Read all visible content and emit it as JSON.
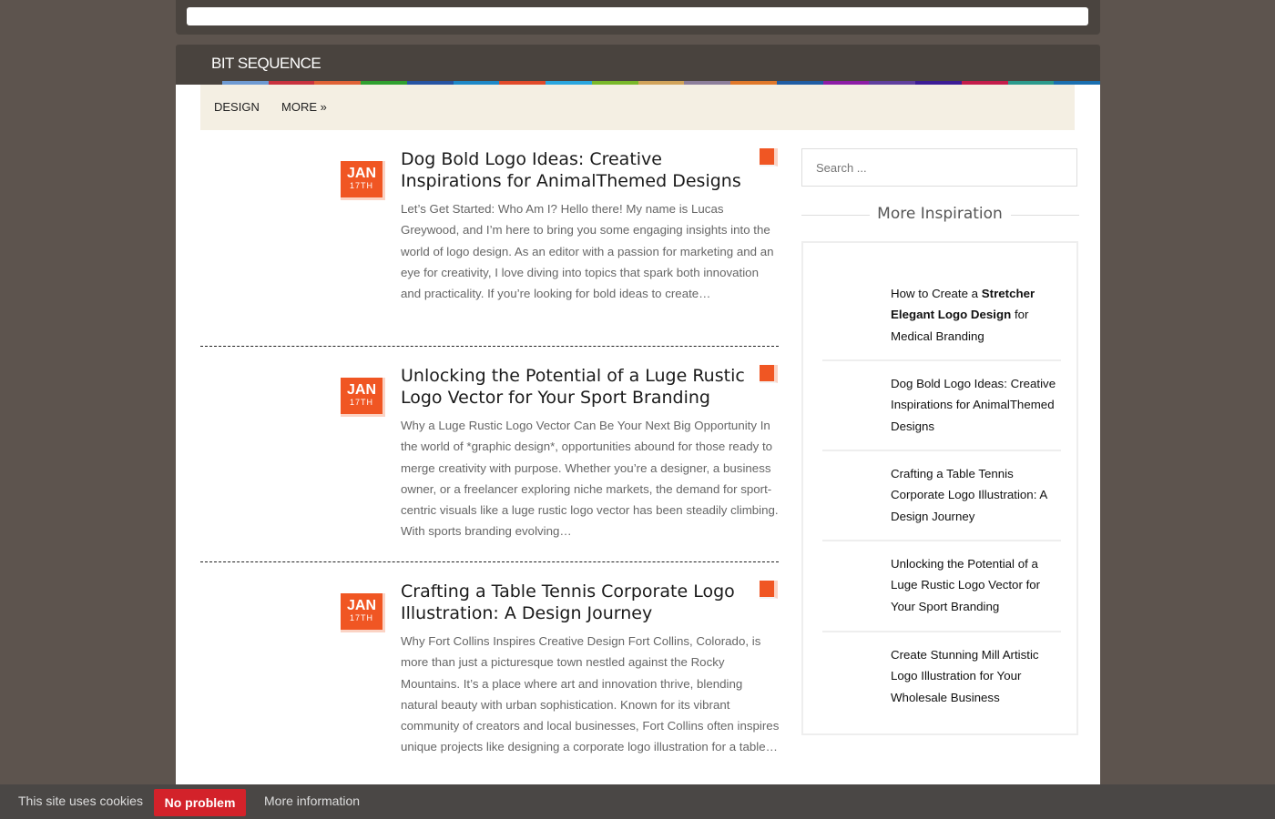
{
  "site": {
    "name": "BIT SEQUENCE"
  },
  "nav": {
    "items": [
      "DESIGN",
      "MORE »"
    ]
  },
  "colors": {
    "accent": "#f05623",
    "stripes": [
      "#49433e",
      "#6e9ad2",
      "#c9323e",
      "#e06236",
      "#2fa02f",
      "#2654a3",
      "#1e88c7",
      "#e14a2a",
      "#2aa6df",
      "#79b82a",
      "#d1a35a",
      "#8c7e9b",
      "#e0782a",
      "#1f5da4",
      "#8d1da6",
      "#5f3f9e",
      "#3c1c96",
      "#c41d4b",
      "#2b9a8c",
      "#1a6fb0"
    ]
  },
  "posts": [
    {
      "month": "JAN",
      "day": "17TH",
      "title": "Dog Bold Logo Ideas: Creative Inspirations for AnimalThemed Designs",
      "excerpt": "Let’s Get Started: Who Am I? Hello there! My name is Lucas Greywood, and I’m here to bring you some engaging insights into the world of logo design. As an editor with a passion for marketing and an eye for creativity, I love diving into topics that spark both innovation and practicality. If you’re looking for bold ideas to create…"
    },
    {
      "month": "JAN",
      "day": "17TH",
      "title": "Unlocking the Potential of a Luge Rustic Logo Vector for Your Sport Branding",
      "excerpt": "Why a Luge Rustic Logo Vector Can Be Your Next Big Opportunity In the world of *graphic design*, opportunities abound for those ready to merge creativity with purpose. Whether you’re a designer, a business owner, or a freelancer exploring niche markets, the demand for sport-centric visuals like a luge rustic logo vector has been steadily climbing. With sports branding evolving…"
    },
    {
      "month": "JAN",
      "day": "17TH",
      "title": "Crafting a Table Tennis Corporate Logo Illustration: A Design Journey",
      "excerpt": "Why Fort Collins Inspires Creative Design Fort Collins, Colorado, is more than just a picturesque town nestled against the Rocky Mountains. It’s a place where art and innovation thrive, blending natural beauty with urban sophistication. Known for its vibrant community of creators and local businesses, Fort Collins often inspires unique projects like designing a corporate logo illustration for a table…"
    }
  ],
  "sidebar": {
    "search_placeholder": "Search ...",
    "widget_title": "More Inspiration",
    "items": [
      {
        "prefix": "How to Create a ",
        "bold": "Stretcher Elegant Logo Design",
        "suffix": " for Medical Branding"
      },
      {
        "text": "Dog Bold Logo Ideas: Creative Inspirations for AnimalThemed Designs"
      },
      {
        "text": "Crafting a Table Tennis Corporate Logo Illustration: A Design Journey"
      },
      {
        "text": "Unlocking the Potential of a Luge Rustic Logo Vector for Your Sport Branding"
      },
      {
        "text": "Create Stunning Mill Artistic Logo Illustration for Your Wholesale Business"
      }
    ]
  },
  "cookie": {
    "text": "This site uses cookies",
    "button": "No problem",
    "more": "More information"
  }
}
